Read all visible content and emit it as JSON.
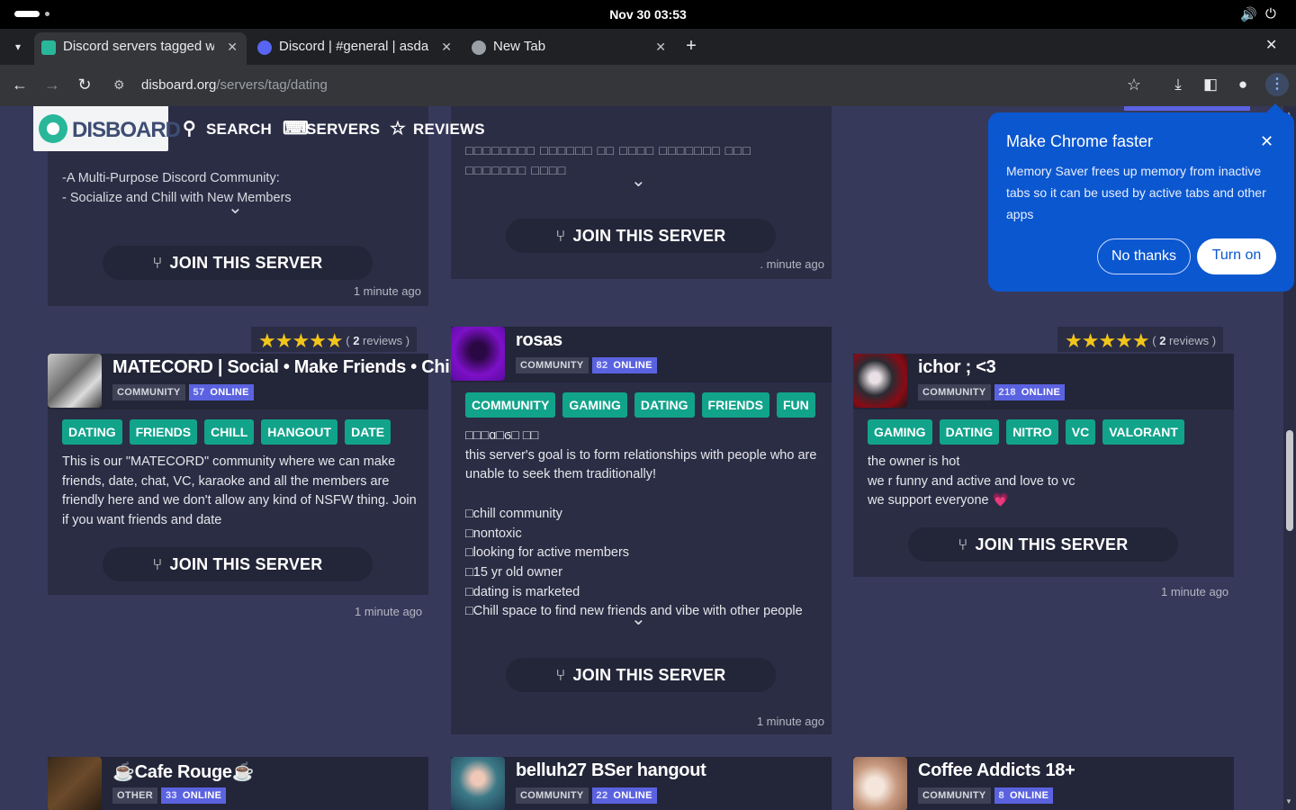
{
  "system": {
    "clock": "Nov 30  03:53",
    "volume_icon": "volume-icon",
    "power_icon": "power-icon"
  },
  "browser": {
    "tabs": [
      {
        "title": "Discord servers tagged w",
        "active": true
      },
      {
        "title": "Discord | #general | asda",
        "active": false
      },
      {
        "title": "New Tab",
        "active": false
      }
    ],
    "url_host": "disboard.org",
    "url_path": "/servers/tag/dating"
  },
  "site": {
    "logo": "DISBOARD",
    "nav": [
      "SEARCH",
      "SERVERS",
      "REVIEWS"
    ]
  },
  "top_cards": [
    {
      "desc": "-A Multi-Purpose Discord Community:\n- Socialize and Chill with New Members",
      "join": "JOIN THIS SERVER",
      "ago": "1 minute ago"
    },
    {
      "desc": "□□□□□□□□ □□□□□□ □□ □□□□ □□□□□□□ □□□\n□□□□□□□ □□□□",
      "join": "JOIN THIS SERVER",
      "ago": ". minute ago"
    }
  ],
  "cards": [
    {
      "name": "MATECORD | Social • Make Friends • Chill •",
      "category": "COMMUNITY",
      "online_count": "57",
      "online_label": "ONLINE",
      "reviews_prefix": "( ",
      "reviews_count": "2",
      "reviews_suffix": " reviews )",
      "tags": [
        "DATING",
        "FRIENDS",
        "CHILL",
        "HANGOUT",
        "DATE"
      ],
      "desc": "This is our \"MATECORD\" community where we can make\nfriends, date, chat, VC, karaoke and all the members are\nfriendly here and we don't allow any kind of NSFW thing. Join\nif you want friends and date",
      "join": "JOIN THIS SERVER",
      "ago": "1 minute ago"
    },
    {
      "name": "rosas",
      "category": "COMMUNITY",
      "online_count": "82",
      "online_label": "ONLINE",
      "tags": [
        "COMMUNITY",
        "GAMING",
        "DATING",
        "FRIENDS",
        "FUN"
      ],
      "desc": "□□□ɑ□ϭ□ □□\nthis server's goal is to form relationships with people who are\nunable to seek them traditionally!\n\n□chill community\n□nontoxic\n□looking for active members\n□15 yr old owner\n□dating is marketed\n□Chill space to find new friends and vibe with other people",
      "join": "JOIN THIS SERVER",
      "ago": "1 minute ago"
    },
    {
      "name": "ichor ; <3",
      "category": "COMMUNITY",
      "online_count": "218",
      "online_label": "ONLINE",
      "reviews_prefix": "( ",
      "reviews_count": "2",
      "reviews_suffix": " reviews )",
      "tags": [
        "GAMING",
        "DATING",
        "NITRO",
        "VC",
        "VALORANT"
      ],
      "desc": "the owner is hot\nwe r funny and active and love to vc\nwe support everyone 💗",
      "join": "JOIN THIS SERVER",
      "ago": "1 minute ago"
    }
  ],
  "bottom_cards": [
    {
      "name": "☕Cafe Rouge☕",
      "category": "OTHER",
      "online_count": "33",
      "online_label": "ONLINE"
    },
    {
      "name": "belluh27 BSer hangout",
      "category": "COMMUNITY",
      "online_count": "22",
      "online_label": "ONLINE"
    },
    {
      "name": "Coffee Addicts 18+",
      "category": "COMMUNITY",
      "online_count": "8",
      "online_label": "ONLINE"
    }
  ],
  "popup": {
    "title": "Make Chrome faster",
    "body": "Memory Saver frees up memory from inactive tabs so it can be used by active tabs and other apps",
    "no": "No thanks",
    "yes": "Turn on"
  },
  "colors": {
    "accent": "#0b57d0",
    "tag": "#12a38b",
    "online": "#5b62e0",
    "star": "#f2c51a",
    "page_bg": "#36395a"
  }
}
